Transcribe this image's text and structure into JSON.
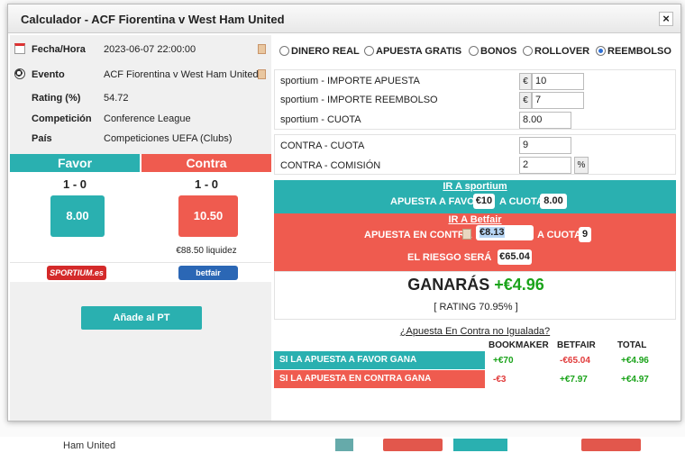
{
  "background": {
    "row_text": "Ham United"
  },
  "modal": {
    "title": "Calculador - ACF Fiorentina v West Ham United",
    "close": "×"
  },
  "info": {
    "fecha_label": "Fecha/Hora",
    "fecha_value": "2023-06-07 22:00:00",
    "evento_label": "Evento",
    "evento_value": "ACF Fiorentina v West Ham United",
    "rating_label": "Rating (%)",
    "rating_value": "54.72",
    "competicion_label": "Competición",
    "competicion_value": "Conference League",
    "pais_label": "País",
    "pais_value": "Competiciones UEFA (Clubs)"
  },
  "odds": {
    "favor_header": "Favor",
    "contra_header": "Contra",
    "favor_score": "1 - 0",
    "contra_score": "1 - 0",
    "favor_odd": "8.00",
    "contra_odd": "10.50",
    "liquidity": "€88.50 liquidez",
    "bookmaker_brand": "SPORTIUM.es",
    "exchange_brand": "betfair"
  },
  "add_button": "Añade al PT",
  "modes": {
    "options": [
      "DINERO REAL",
      "APUESTA GRATIS",
      "BONOS",
      "ROLLOVER",
      "REEMBOLSO"
    ],
    "selected": "REEMBOLSO"
  },
  "form": {
    "importe_apuesta_label": "sportium - IMPORTE APUESTA",
    "importe_apuesta_value": "10",
    "importe_reembolso_label": "sportium - IMPORTE REEMBOLSO",
    "importe_reembolso_value": "7",
    "cuota_label": "sportium - CUOTA",
    "cuota_value": "8.00",
    "contra_cuota_label": "CONTRA - CUOTA",
    "contra_cuota_value": "9",
    "contra_comision_label": "CONTRA - COMISIÓN",
    "contra_comision_value": "2",
    "currency": "€",
    "percent": "%"
  },
  "bet_favor": {
    "link": "IR A sportium",
    "label": "APUESTA A FAVOR",
    "amount": "€10",
    "cuota_label": "A CUOTA",
    "cuota": "8.00"
  },
  "bet_contra": {
    "link": "IR A Betfair",
    "label": "APUESTA EN CONTRA",
    "amount": "€8.13",
    "cuota_label": "A CUOTA",
    "cuota": "9",
    "riesgo_label": "EL RIESGO SERÁ",
    "riesgo": "€65.04"
  },
  "result": {
    "ganaras_label": "GANARÁS",
    "ganaras_value": "+€4.96",
    "rating": "[ RATING 70.95% ]"
  },
  "unmatched_link": "¿Apuesta En Contra no Igualada?",
  "table": {
    "headers": [
      "BOOKMAKER",
      "BETFAIR",
      "TOTAL"
    ],
    "rows": [
      {
        "label": "SI LA APUESTA A FAVOR GANA",
        "bookmaker": "+€70",
        "betfair": "-€65.04",
        "total": "+€4.96"
      },
      {
        "label": "SI LA APUESTA EN CONTRA GANA",
        "bookmaker": "-€3",
        "betfair": "+€7.97",
        "total": "+€4.97"
      }
    ]
  },
  "colors": {
    "teal": "#2ab0b0",
    "red": "#ef5b4f",
    "positive": "#1aa31a",
    "negative": "#e13b3b"
  }
}
